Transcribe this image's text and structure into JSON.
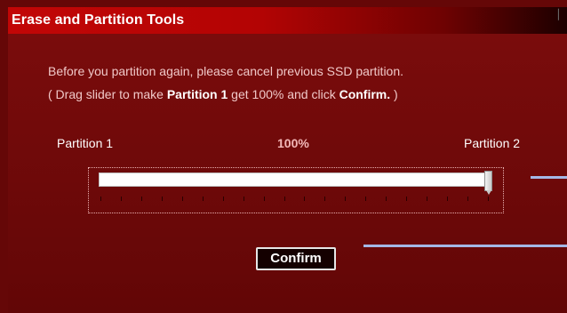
{
  "window": {
    "title": "Erase and Partition Tools",
    "close_icon": "close-icon"
  },
  "instructions": {
    "line1": "Before you partition again, please cancel previous SSD partition.",
    "line2_a": "( Drag slider to make ",
    "line2_b": "Partition 1",
    "line2_c": " get 100% and  click ",
    "line2_d": "Confirm.",
    "line2_e": " )"
  },
  "slider": {
    "left_label": "Partition 1",
    "right_label": "Partition 2",
    "value_text": "100%",
    "value_fraction": 1.0,
    "tick_count": 20
  },
  "confirm_button": {
    "label": "Confirm"
  },
  "colors": {
    "background": "#650707",
    "titlebar": "#c20606",
    "callout_line": "#a4b8e6"
  }
}
